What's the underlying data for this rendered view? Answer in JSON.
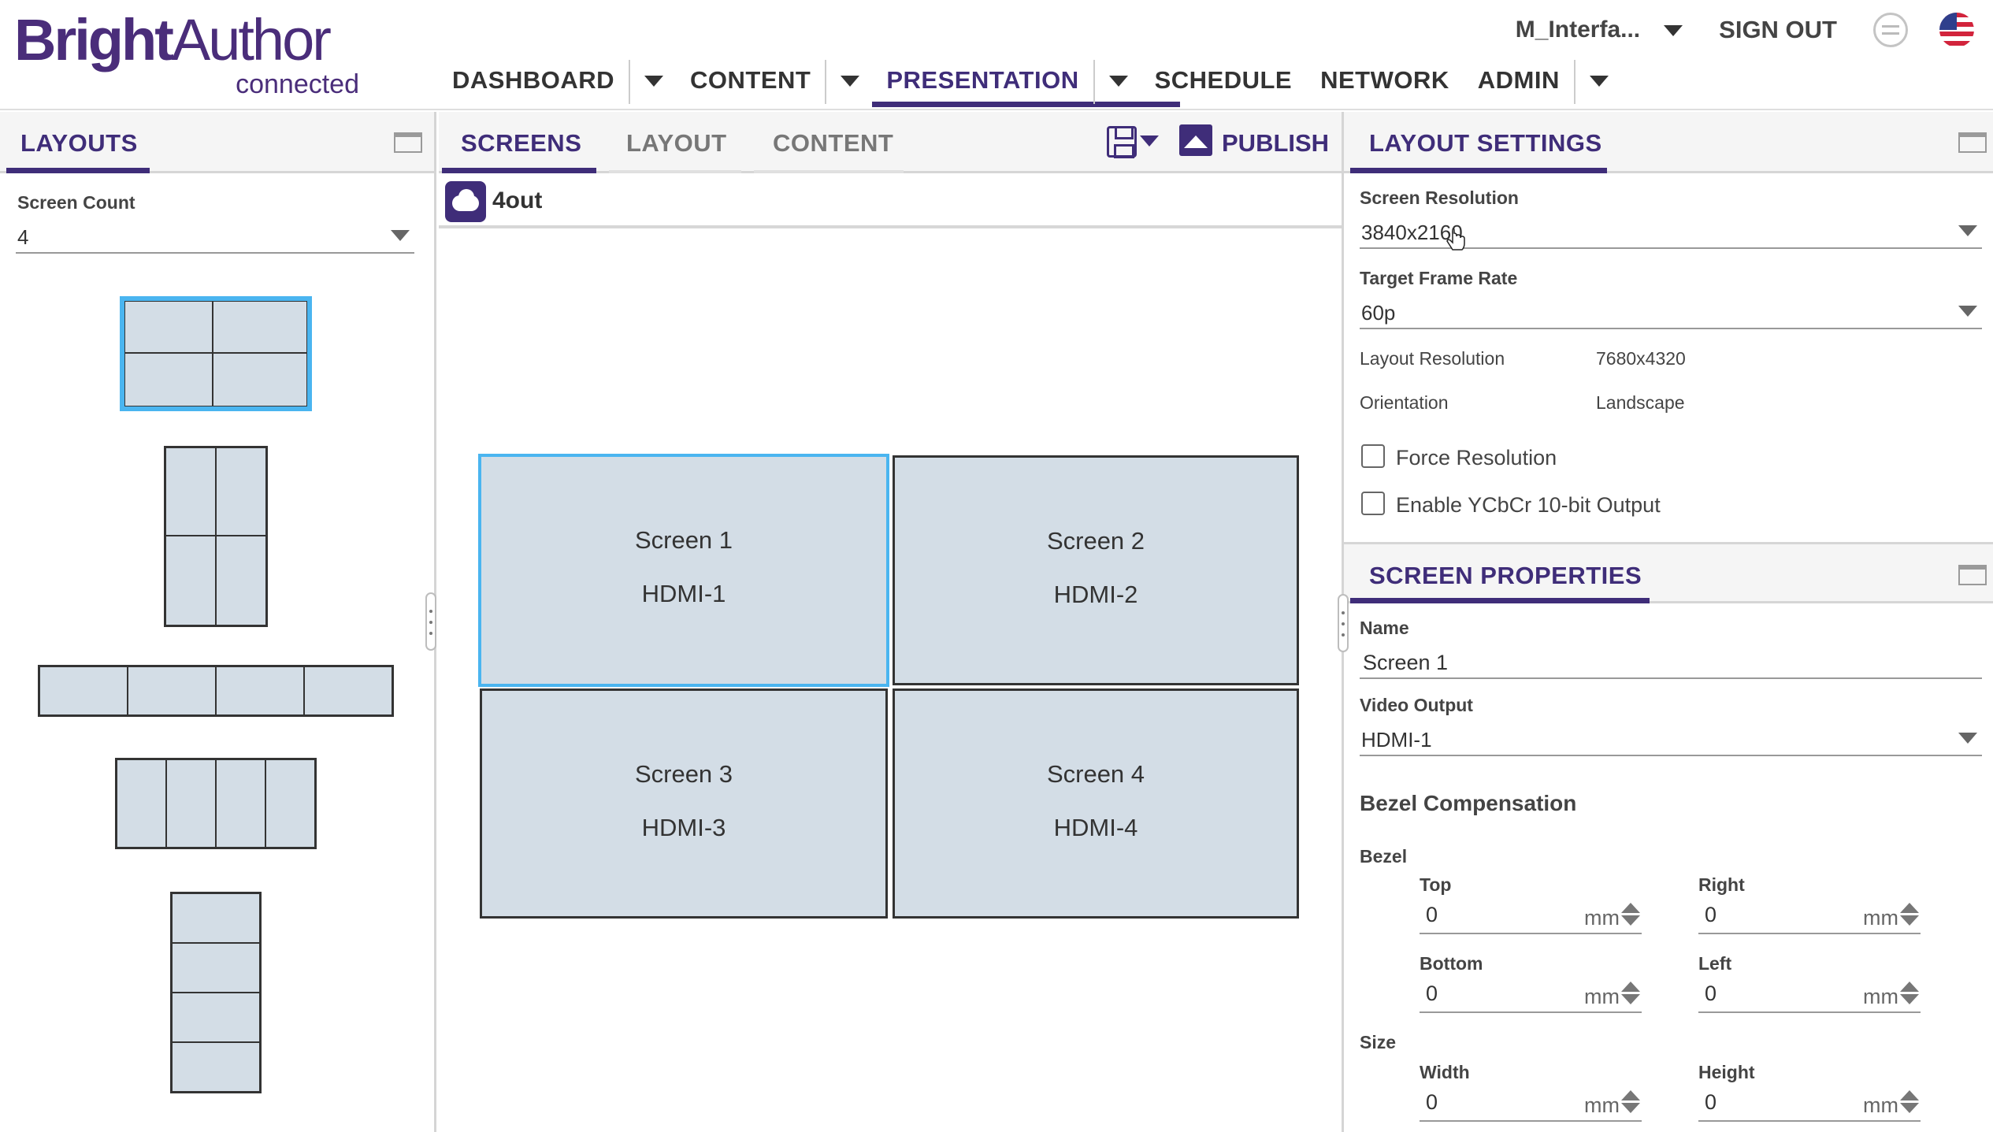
{
  "brand": {
    "name_bold": "Bright",
    "name_regular": "Author",
    "subtitle": "connected"
  },
  "nav": {
    "items": [
      {
        "label": "DASHBOARD"
      },
      {
        "label": "CONTENT"
      },
      {
        "label": "PRESENTATION",
        "active": true
      },
      {
        "label": "SCHEDULE"
      },
      {
        "label": "NETWORK"
      },
      {
        "label": "ADMIN"
      }
    ]
  },
  "topright": {
    "user": "M_Interfa...",
    "signout": "SIGN OUT",
    "sync_icon": "sync-icon",
    "locale_icon": "us-flag-icon"
  },
  "layouts_panel": {
    "title": "LAYOUTS",
    "screen_count_label": "Screen Count",
    "screen_count_value": "4"
  },
  "center": {
    "tabs": [
      {
        "label": "SCREENS",
        "active": true
      },
      {
        "label": "LAYOUT"
      },
      {
        "label": "CONTENT"
      }
    ],
    "publish_label": "PUBLISH",
    "presentation_name": "4out",
    "screens": [
      {
        "name": "Screen 1",
        "output": "HDMI-1",
        "selected": true
      },
      {
        "name": "Screen 2",
        "output": "HDMI-2"
      },
      {
        "name": "Screen 3",
        "output": "HDMI-3"
      },
      {
        "name": "Screen 4",
        "output": "HDMI-4"
      }
    ]
  },
  "layout_settings": {
    "title": "LAYOUT SETTINGS",
    "screen_resolution_label": "Screen Resolution",
    "screen_resolution_value": "3840x2160",
    "frame_rate_label": "Target Frame Rate",
    "frame_rate_value": "60p",
    "layout_resolution_label": "Layout Resolution",
    "layout_resolution_value": "7680x4320",
    "orientation_label": "Orientation",
    "orientation_value": "Landscape",
    "force_resolution_label": "Force Resolution",
    "force_resolution_checked": false,
    "ycbcr_label": "Enable YCbCr 10-bit Output",
    "ycbcr_checked": false
  },
  "screen_properties": {
    "title": "SCREEN PROPERTIES",
    "name_label": "Name",
    "name_value": "Screen 1",
    "video_output_label": "Video Output",
    "video_output_value": "HDMI-1",
    "bezel_comp_title": "Bezel Compensation",
    "bezel_label": "Bezel",
    "size_label": "Size",
    "unit": "mm",
    "bezel": {
      "top_label": "Top",
      "top_value": "0",
      "right_label": "Right",
      "right_value": "0",
      "bottom_label": "Bottom",
      "bottom_value": "0",
      "left_label": "Left",
      "left_value": "0"
    },
    "size": {
      "width_label": "Width",
      "width_value": "0",
      "height_label": "Height",
      "height_value": "0"
    }
  },
  "colors": {
    "brand_purple": "#3f2d79",
    "selection_blue": "#4ab5f0",
    "screen_fill": "#d3dde6"
  }
}
